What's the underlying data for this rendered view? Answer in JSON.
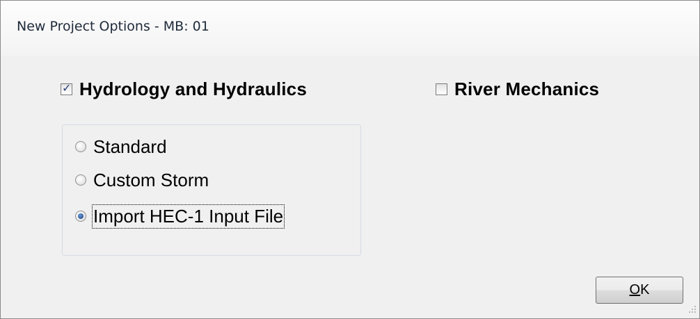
{
  "window": {
    "title": "New Project Options - MB: 01"
  },
  "options": {
    "hydrology": {
      "label": "Hydrology and Hydraulics",
      "checked": true
    },
    "river": {
      "label": "River Mechanics",
      "checked": false
    }
  },
  "hydrology_mode": {
    "selected": "Import HEC-1 Input File",
    "items": [
      {
        "label": "Standard",
        "selected": false
      },
      {
        "label": "Custom Storm",
        "selected": false
      },
      {
        "label": "Import HEC-1 Input File",
        "selected": true
      }
    ]
  },
  "buttons": {
    "ok_mnemonic": "O",
    "ok_rest": "K"
  },
  "icons": {
    "check": "check-icon",
    "radio_dot": "radio-dot-icon",
    "resize_grip": "resize-grip-icon"
  }
}
